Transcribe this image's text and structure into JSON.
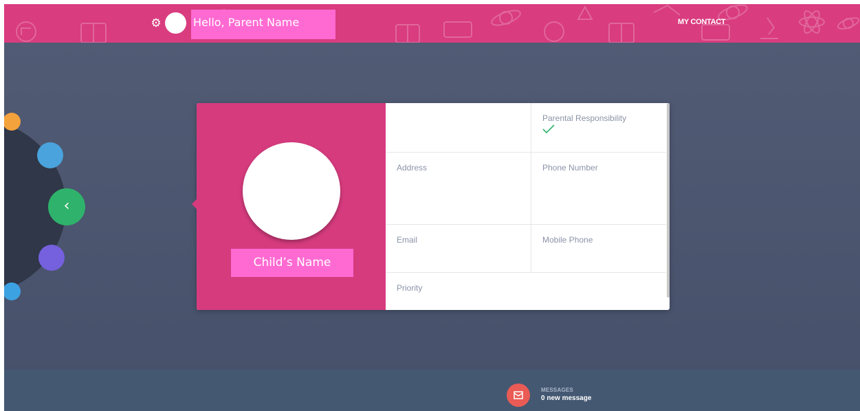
{
  "header": {
    "greeting": "Hello, Parent Name",
    "settings_icon": "gear-icon",
    "nav_link": "MY CONTACT",
    "colors": {
      "header_bg": "#d93c7f",
      "greeting_bg": "#ff6ad2"
    }
  },
  "side_menu": {
    "items": [
      {
        "icon": "circle-icon",
        "color": "#f3a23c"
      },
      {
        "icon": "circle-icon",
        "color": "#4aa3dc"
      },
      {
        "icon": "chevron-left-icon",
        "color": "#2fb26b"
      },
      {
        "icon": "circle-icon",
        "color": "#7560de"
      },
      {
        "icon": "circle-icon",
        "color": "#3da2e2"
      }
    ]
  },
  "contact_card": {
    "child_name": "Child’s Name",
    "fields": {
      "parental_responsibility": {
        "label": "Parental Responsibility",
        "value_icon": "checkmark-icon"
      },
      "address": {
        "label": "Address",
        "value": ""
      },
      "phone_number": {
        "label": "Phone Number",
        "value": ""
      },
      "email": {
        "label": "Email",
        "value": ""
      },
      "mobile_phone": {
        "label": "Mobile Phone",
        "value": ""
      },
      "priority": {
        "label": "Priority",
        "value": ""
      }
    },
    "colors": {
      "panel_bg": "#d63b7e",
      "name_bg": "#ff6ad2",
      "check": "#2fb26b"
    }
  },
  "footer": {
    "messages_title": "MESSAGES",
    "messages_count": "0 new message",
    "icon": "mail-icon",
    "colors": {
      "icon_bg": "#ea5b55",
      "footer_bg": "#445872"
    }
  }
}
